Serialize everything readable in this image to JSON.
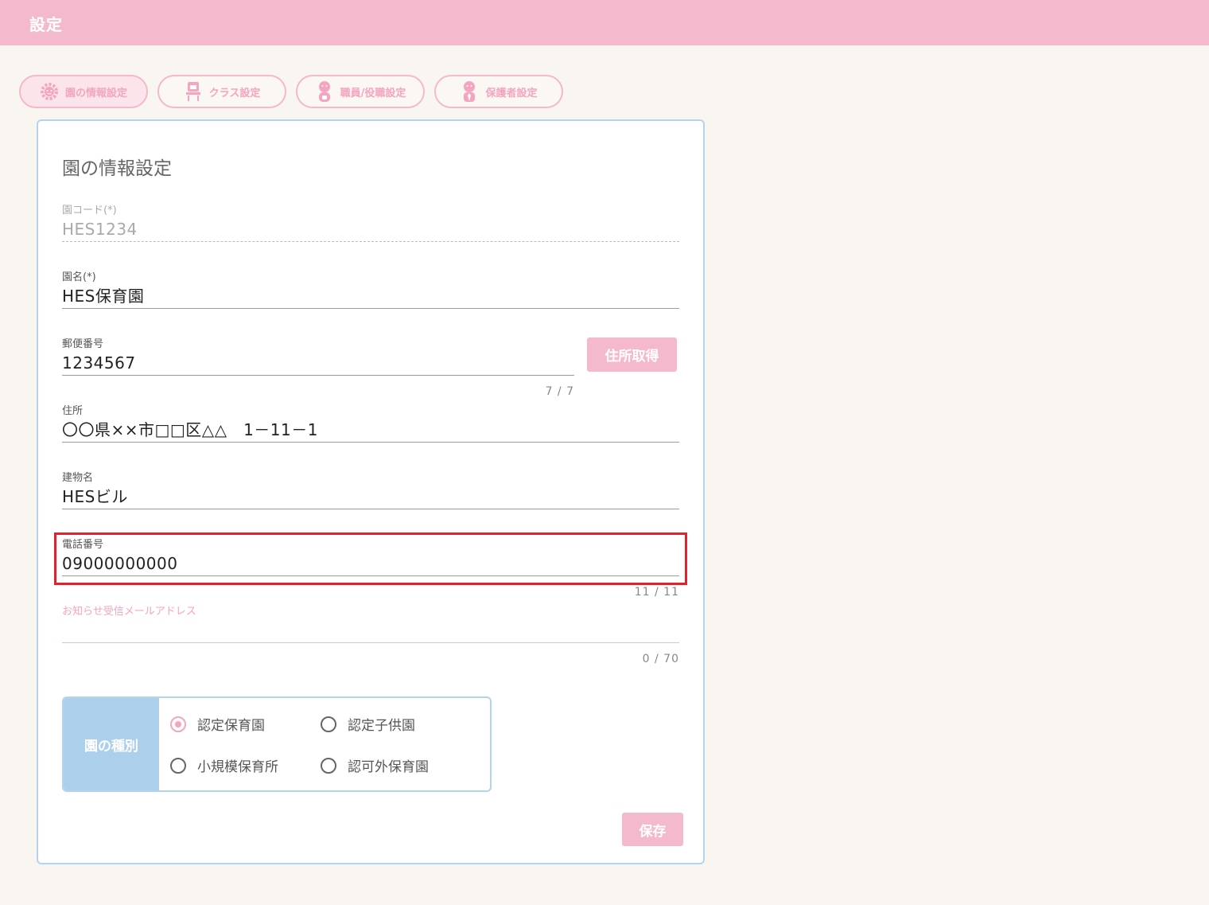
{
  "header": {
    "title": "設定"
  },
  "tabs": [
    {
      "label": "園の情報設定",
      "icon": "gear-icon",
      "active": true
    },
    {
      "label": "クラス設定",
      "icon": "class-icon",
      "active": false
    },
    {
      "label": "職員/役職設定",
      "icon": "staff-icon",
      "active": false
    },
    {
      "label": "保護者設定",
      "icon": "guardian-icon",
      "active": false
    }
  ],
  "form": {
    "title": "園の情報設定",
    "code": {
      "label": "園コード(*)",
      "value": "HES1234"
    },
    "name": {
      "label": "園名(*)",
      "value": "HES保育園"
    },
    "postal": {
      "label": "郵便番号",
      "value": "1234567",
      "counter": "7 / 7"
    },
    "address_button": "住所取得",
    "address": {
      "label": "住所",
      "value": "〇〇県××市□□区△△　1－11－1"
    },
    "building": {
      "label": "建物名",
      "value": "HESビル"
    },
    "phone": {
      "label": "電話番号",
      "value": "09000000000",
      "counter": "11 / 11"
    },
    "email": {
      "label": "お知らせ受信メールアドレス",
      "value": "",
      "counter": "0 / 70"
    },
    "type": {
      "label": "園の種別",
      "options": [
        {
          "label": "認定保育園",
          "checked": true
        },
        {
          "label": "認定子供園",
          "checked": false
        },
        {
          "label": "小規模保育所",
          "checked": false
        },
        {
          "label": "認可外保育園",
          "checked": false
        }
      ]
    },
    "save_button": "保存"
  },
  "colors": {
    "accent_pink": "#f4b9cd",
    "accent_blue": "#acd0eb",
    "highlight_red": "#e3202b",
    "background": "#f9f6f1"
  }
}
